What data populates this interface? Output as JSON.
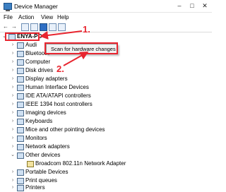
{
  "window": {
    "title": "Device Manager"
  },
  "menu": [
    "File",
    "Action",
    "View",
    "Help"
  ],
  "toolbar": {
    "back": "←",
    "forward": "→"
  },
  "tree": {
    "root": "ENYA-PC",
    "items": [
      "Audi",
      "Bluetooth",
      "Computer",
      "Disk drives",
      "Display adapters",
      "Human Interface Devices",
      "IDE ATA/ATAPI controllers",
      "IEEE 1394 host controllers",
      "Imaging devices",
      "Keyboards",
      "Mice and other pointing devices",
      "Monitors",
      "Network adapters",
      "Other devices",
      "Broadcom 802.11n Network Adapter",
      "Portable Devices",
      "Print queues",
      "Printers"
    ]
  },
  "context_menu": {
    "item": "Scan for hardware changes"
  },
  "annotations": {
    "step1": "1.",
    "step2": "2."
  }
}
